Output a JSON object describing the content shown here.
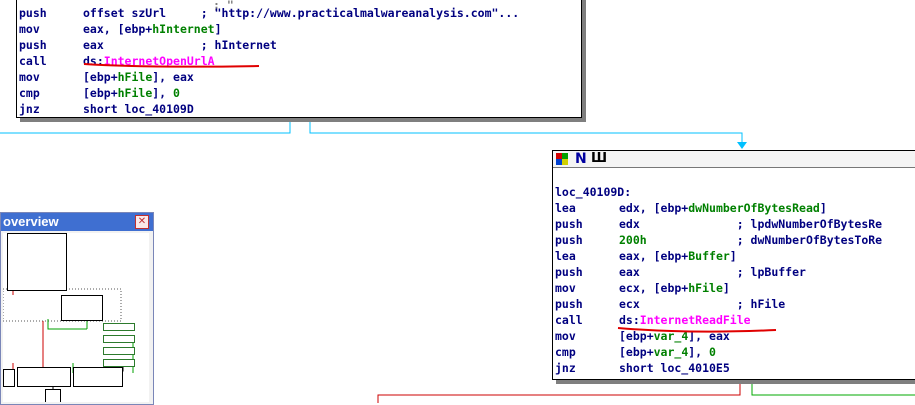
{
  "node_top": {
    "truncated_fragment": "; \"",
    "lines": [
      {
        "mn": "push",
        "op": [
          {
            "t": "offset szUrl     ; \"http://www.practicalmalwareanalysis.com\"...",
            "c": ""
          }
        ]
      },
      {
        "mn": "mov",
        "op": [
          {
            "t": "eax, [ebp+",
            "c": ""
          },
          {
            "t": "hInternet",
            "c": "acc"
          },
          {
            "t": "]",
            "c": ""
          }
        ]
      },
      {
        "mn": "push",
        "op": [
          {
            "t": "eax              ; hInternet",
            "c": ""
          }
        ]
      },
      {
        "mn": "call",
        "op": [
          {
            "t": "ds:",
            "c": ""
          },
          {
            "t": "InternetOpenUrlA",
            "c": "imp"
          }
        ]
      },
      {
        "mn": "mov",
        "op": [
          {
            "t": "[ebp+",
            "c": ""
          },
          {
            "t": "hFile",
            "c": "acc"
          },
          {
            "t": "], eax",
            "c": ""
          }
        ]
      },
      {
        "mn": "cmp",
        "op": [
          {
            "t": "[ebp+",
            "c": ""
          },
          {
            "t": "hFile",
            "c": "acc"
          },
          {
            "t": "], ",
            "c": ""
          },
          {
            "t": "0",
            "c": "num"
          }
        ]
      },
      {
        "mn": "jnz",
        "op": [
          {
            "t": "short loc_40109D",
            "c": ""
          }
        ]
      }
    ]
  },
  "node_right": {
    "header_icons": [
      "color-icon",
      "name-icon",
      "graph-icon"
    ],
    "header_glyphs": [
      "",
      "N",
      "Ш"
    ],
    "label": "loc_40109D:",
    "lines": [
      {
        "mn": "lea",
        "op": [
          {
            "t": "edx, [ebp+",
            "c": ""
          },
          {
            "t": "dwNumberOfBytesRead",
            "c": "acc"
          },
          {
            "t": "]",
            "c": ""
          }
        ]
      },
      {
        "mn": "push",
        "op": [
          {
            "t": "edx              ; lpdwNumberOfBytesRe",
            "c": ""
          }
        ]
      },
      {
        "mn": "push",
        "op": [
          {
            "t": "200h",
            "c": "num"
          },
          {
            "t": "             ; dwNumberOfBytesToRe",
            "c": ""
          }
        ]
      },
      {
        "mn": "lea",
        "op": [
          {
            "t": "eax, [ebp+",
            "c": ""
          },
          {
            "t": "Buffer",
            "c": "acc"
          },
          {
            "t": "]",
            "c": ""
          }
        ]
      },
      {
        "mn": "push",
        "op": [
          {
            "t": "eax              ; lpBuffer",
            "c": ""
          }
        ]
      },
      {
        "mn": "mov",
        "op": [
          {
            "t": "ecx, [ebp+",
            "c": ""
          },
          {
            "t": "hFile",
            "c": "acc"
          },
          {
            "t": "]",
            "c": ""
          }
        ]
      },
      {
        "mn": "push",
        "op": [
          {
            "t": "ecx              ; hFile",
            "c": ""
          }
        ]
      },
      {
        "mn": "call",
        "op": [
          {
            "t": "ds:",
            "c": ""
          },
          {
            "t": "InternetReadFile",
            "c": "imp"
          }
        ]
      },
      {
        "mn": "mov",
        "op": [
          {
            "t": "[ebp+",
            "c": ""
          },
          {
            "t": "var_4",
            "c": "acc"
          },
          {
            "t": "], eax",
            "c": ""
          }
        ]
      },
      {
        "mn": "cmp",
        "op": [
          {
            "t": "[ebp+",
            "c": ""
          },
          {
            "t": "var_4",
            "c": "acc"
          },
          {
            "t": "], ",
            "c": ""
          },
          {
            "t": "0",
            "c": "num"
          }
        ]
      },
      {
        "mn": "jnz",
        "op": [
          {
            "t": "short loc_4010E5",
            "c": ""
          }
        ]
      }
    ]
  },
  "overview": {
    "title": "overview",
    "close_glyph": "✕"
  },
  "colors": {
    "edge_true": "#00aa00",
    "edge_false": "#cc0000",
    "edge_flow": "#00c0ff",
    "annotation": "#e00000"
  }
}
